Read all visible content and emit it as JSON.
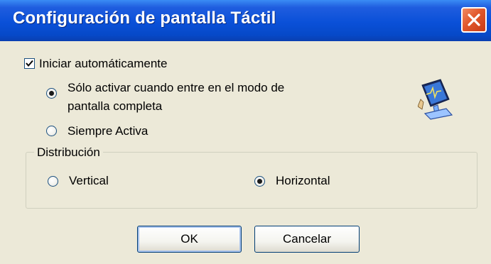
{
  "window": {
    "title": "Configuración de pantalla Táctil"
  },
  "options": {
    "autostart": {
      "label": "Iniciar automáticamente",
      "checked": true
    },
    "mode_fullscreen": {
      "line1": "Sólo activar cuando entre en el modo de",
      "line2": "pantalla completa",
      "selected": true
    },
    "mode_always": {
      "label": "Siempre Activa",
      "selected": false
    }
  },
  "distribution": {
    "legend": "Distribución",
    "vertical": {
      "label": "Vertical",
      "selected": false
    },
    "horizontal": {
      "label": "Horizontal",
      "selected": true
    }
  },
  "buttons": {
    "ok": "OK",
    "cancel": "Cancelar"
  },
  "colors": {
    "titlebar": "#0a50d8",
    "close_button": "#e1582c",
    "dialog_background": "#ece9d8",
    "radio_selected": "#21a121"
  },
  "icons": {
    "close": "close-icon",
    "touch_monitor": "touch-monitor-icon"
  }
}
